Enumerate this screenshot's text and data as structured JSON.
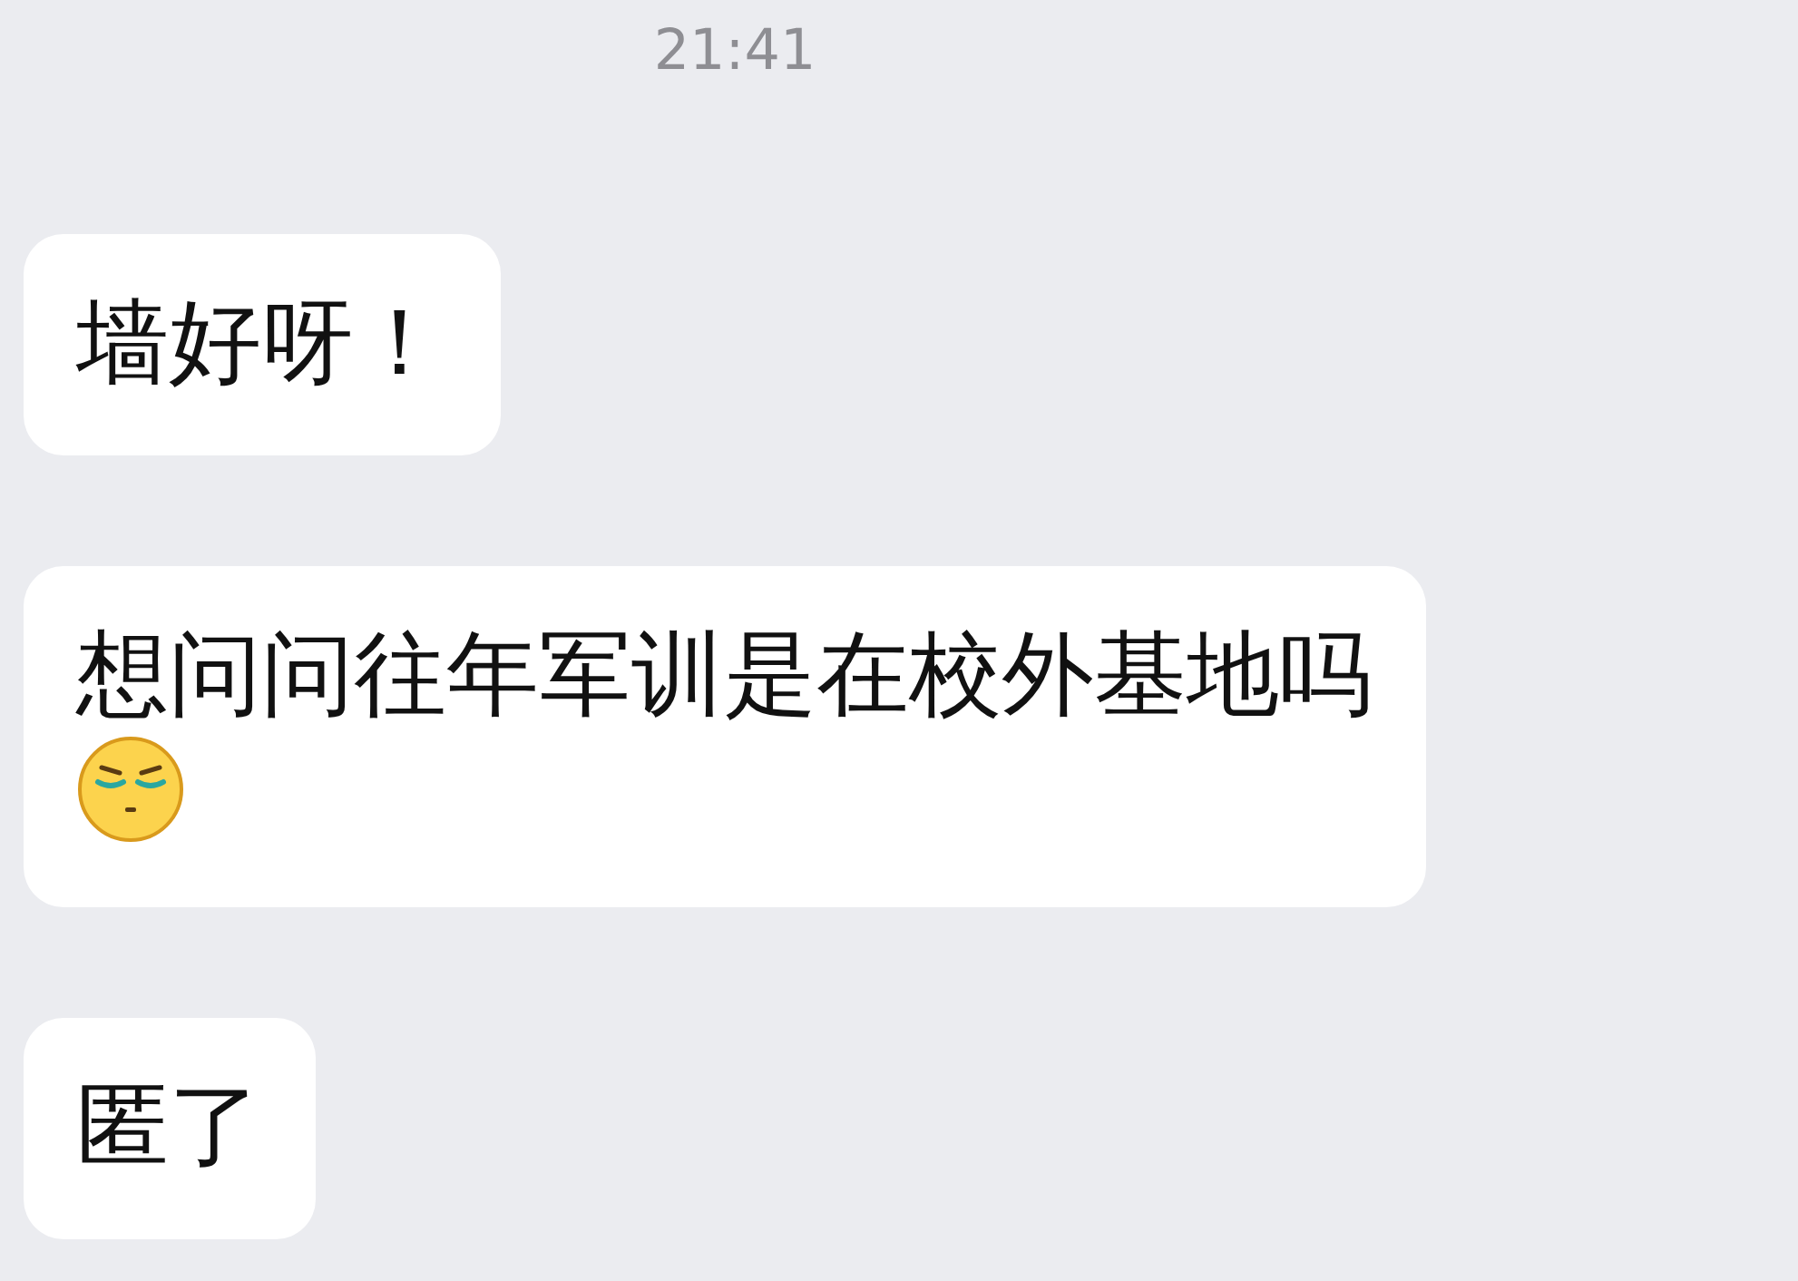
{
  "timestamp": "21:41",
  "messages": [
    {
      "text": "墙好呀！",
      "has_emoji": false
    },
    {
      "text": "想问问往年军训是在校外基地吗",
      "has_emoji": true
    },
    {
      "text": "匿了",
      "has_emoji": false
    }
  ]
}
